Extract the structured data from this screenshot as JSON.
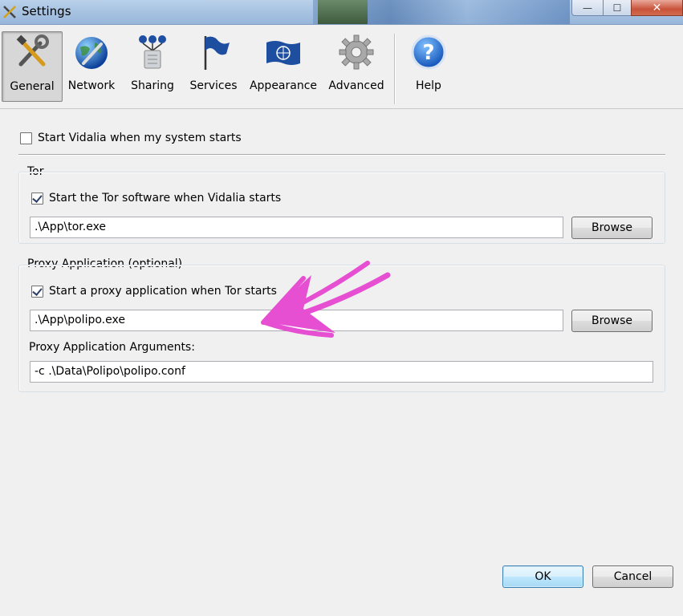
{
  "window": {
    "title": "Settings",
    "min_glyph": "—",
    "max_glyph": "☐",
    "close_glyph": "✕"
  },
  "toolbar": {
    "items": [
      {
        "label": "General",
        "icon": "tools-icon",
        "selected": true
      },
      {
        "label": "Network",
        "icon": "globe-wrench-icon",
        "selected": false
      },
      {
        "label": "Sharing",
        "icon": "relay-network-icon",
        "selected": false
      },
      {
        "label": "Services",
        "icon": "flag-icon",
        "selected": false
      },
      {
        "label": "Appearance",
        "icon": "un-flag-icon",
        "selected": false
      },
      {
        "label": "Advanced",
        "icon": "gear-icon",
        "selected": false
      },
      {
        "label": "Help",
        "icon": "help-icon",
        "selected": false
      }
    ]
  },
  "general": {
    "start_vidalia_label": "Start Vidalia when my system starts",
    "start_vidalia_checked": false
  },
  "tor_group": {
    "title": "Tor",
    "start_tor_label": "Start the Tor software when Vidalia starts",
    "start_tor_checked": true,
    "path_value": ".\\App\\tor.exe",
    "browse_label": "Browse"
  },
  "proxy_group": {
    "title": "Proxy Application (optional)",
    "start_proxy_label": "Start a proxy application when Tor starts",
    "start_proxy_checked": true,
    "path_value": ".\\App\\polipo.exe",
    "browse_label": "Browse",
    "args_label": "Proxy Application Arguments:",
    "args_value": "-c .\\Data\\Polipo\\polipo.conf"
  },
  "footer": {
    "ok_label": "OK",
    "cancel_label": "Cancel"
  },
  "annotation": {
    "arrow_color": "#e64fd2"
  }
}
